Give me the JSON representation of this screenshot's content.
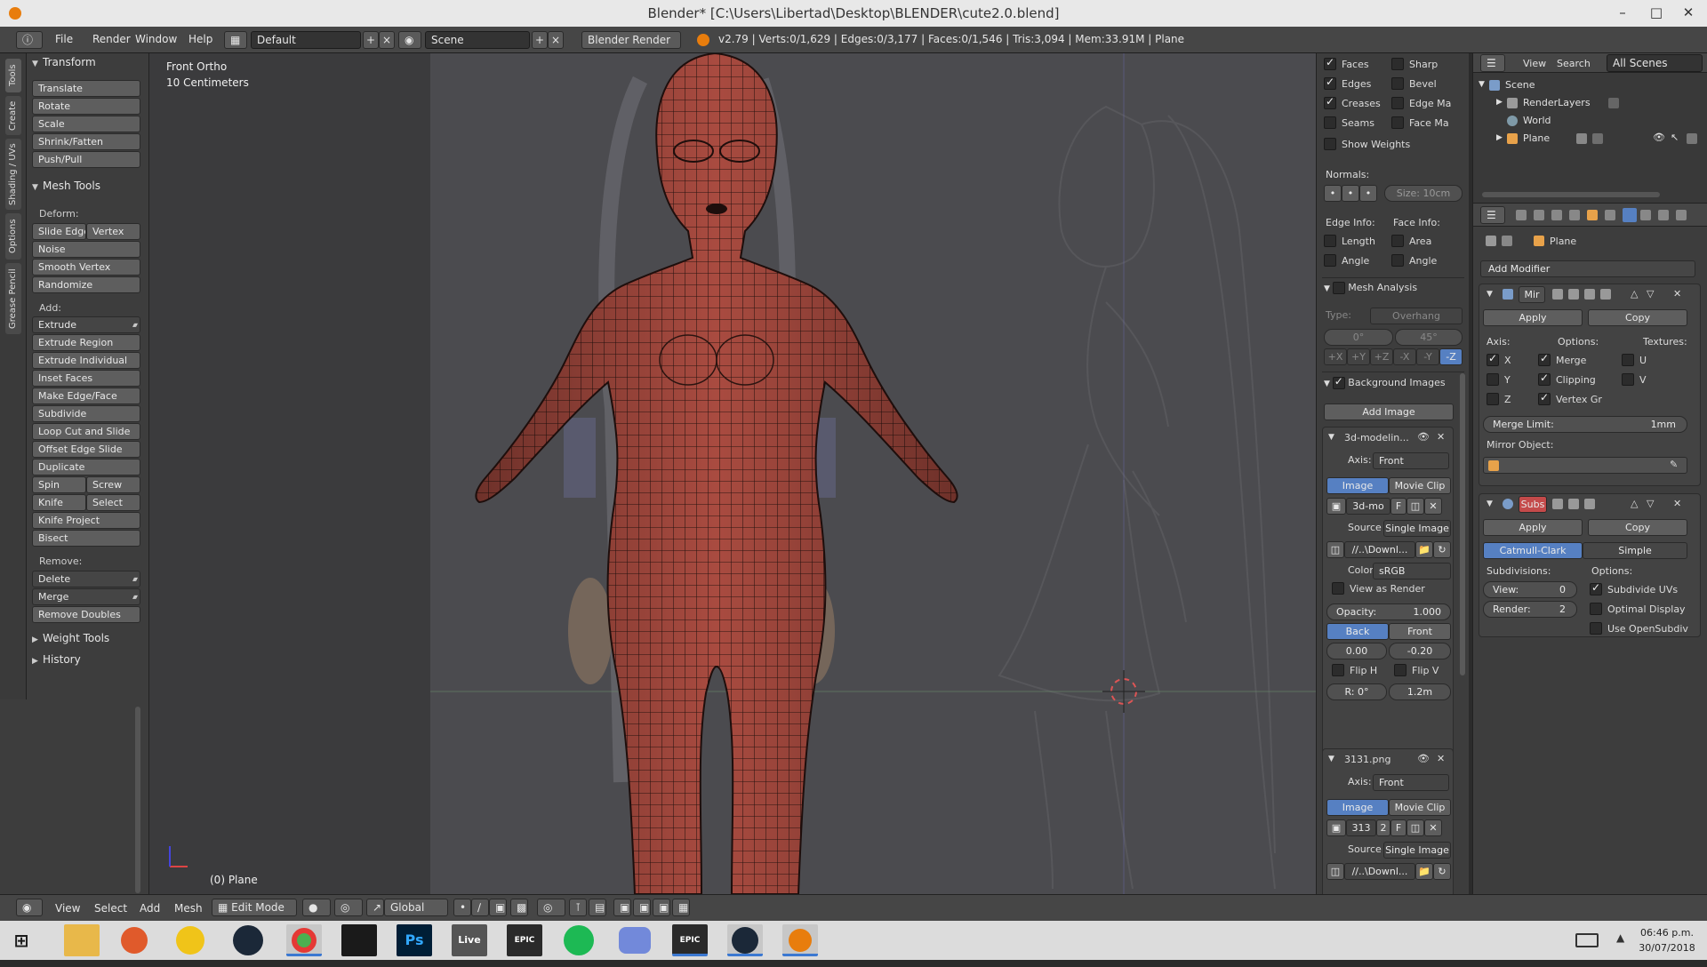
{
  "window": {
    "title": "Blender* [C:\\Users\\Libertad\\Desktop\\BLENDER\\cute2.0.blend]",
    "minimize": "–",
    "maximize": "□",
    "close": "✕"
  },
  "info_header": {
    "menus": [
      "File",
      "Render",
      "Window",
      "Help"
    ],
    "layout": "Default",
    "scene": "Scene",
    "engine": "Blender Render",
    "stats": "v2.79 | Verts:0/1,629 | Edges:0/3,177 | Faces:0/1,546 | Tris:3,094 | Mem:33.91M | Plane"
  },
  "tool_tabs": [
    "Tools",
    "Create",
    "Shading / UVs",
    "Options",
    "Grease Pencil"
  ],
  "tool_shelf": {
    "transform": {
      "title": "Transform",
      "buttons": [
        "Translate",
        "Rotate",
        "Scale",
        "Shrink/Fatten",
        "Push/Pull"
      ]
    },
    "mesh_tools": {
      "title": "Mesh Tools",
      "deform_label": "Deform:",
      "slide_edge": "Slide Edge",
      "vertex": "Vertex",
      "noise": "Noise",
      "smooth_vertex": "Smooth Vertex",
      "randomize": "Randomize",
      "add_label": "Add:",
      "extrude": "Extrude",
      "extrude_region": "Extrude Region",
      "extrude_individual": "Extrude Individual",
      "inset_faces": "Inset Faces",
      "make_edge_face": "Make Edge/Face",
      "subdivide": "Subdivide",
      "loop_cut": "Loop Cut and Slide",
      "offset_edge_slide": "Offset Edge Slide",
      "duplicate": "Duplicate",
      "spin": "Spin",
      "screw": "Screw",
      "knife": "Knife",
      "select": "Select",
      "knife_project": "Knife Project",
      "bisect": "Bisect",
      "remove_label": "Remove:",
      "delete": "Delete",
      "merge": "Merge",
      "remove_doubles": "Remove Doubles"
    },
    "weight_tools": "Weight Tools",
    "history": "History"
  },
  "viewport": {
    "view_name": "Front Ortho",
    "scale": "10 Centimeters",
    "object_label": "(0) Plane"
  },
  "npanel": {
    "overlays": [
      {
        "label": "Faces",
        "on": true
      },
      {
        "label": "Sharp",
        "on": false
      },
      {
        "label": "Edges",
        "on": true
      },
      {
        "label": "Bevel",
        "on": false
      },
      {
        "label": "Creases",
        "on": true
      },
      {
        "label": "Edge Ma",
        "on": false
      },
      {
        "label": "Seams",
        "on": false
      },
      {
        "label": "Face Ma",
        "on": false
      }
    ],
    "show_weights": "Show Weights",
    "normals_label": "Normals:",
    "normals_size": "Size: 10cm",
    "edge_info": "Edge Info:",
    "face_info": "Face Info:",
    "length": "Length",
    "area": "Area",
    "angle_e": "Angle",
    "angle_f": "Angle",
    "mesh_analysis": "Mesh Analysis",
    "type_label": "Type:",
    "type_value": "Overhang",
    "min_angle": "0°",
    "max_angle": "45°",
    "axes": [
      "+X",
      "+Y",
      "+Z",
      "-X",
      "-Y",
      "-Z"
    ],
    "background_images": "Background Images",
    "add_image": "Add Image",
    "bg1": {
      "name": "3d-modelin...",
      "axis_label": "Axis:",
      "axis": "Front",
      "image_tab": "Image",
      "movie_tab": "Movie Clip",
      "img_name": "3d-mo",
      "f_label": "F",
      "source_label": "Source",
      "source": "Single Image",
      "path": "//..\\Downl...",
      "color_label": "Color",
      "color": "sRGB",
      "view_as_render": "View as Render",
      "opacity": "Opacity:",
      "opacity_value": "1.000",
      "back": "Back",
      "front": "Front",
      "x_offset": "0.00",
      "y_offset": "-0.20",
      "flip_h": "Flip H",
      "flip_v": "Flip V",
      "rotation": "R: 0°",
      "size": "1.2m"
    },
    "bg2": {
      "name": "3131.png",
      "axis_label": "Axis:",
      "axis": "Front",
      "image_tab": "Image",
      "movie_tab": "Movie Clip",
      "img_name": "313",
      "users": "2",
      "f_label": "F",
      "source_label": "Source",
      "source": "Single Image",
      "path": "//..\\Downl..."
    }
  },
  "outliner": {
    "view": "View",
    "search": "Search",
    "filter": "All Scenes",
    "items": [
      "Scene",
      "RenderLayers",
      "World",
      "Plane"
    ]
  },
  "properties": {
    "breadcrumb": "Plane",
    "add_modifier": "Add Modifier",
    "mirror": {
      "name": "Mir",
      "apply": "Apply",
      "copy": "Copy",
      "axis_label": "Axis:",
      "options_label": "Options:",
      "textures_label": "Textures:",
      "x": "X",
      "y": "Y",
      "z": "Z",
      "merge": "Merge",
      "clipping": "Clipping",
      "vertex_gr": "Vertex Gr",
      "u": "U",
      "v": "V",
      "merge_limit": "Merge Limit:",
      "merge_limit_value": "1mm",
      "mirror_object": "Mirror Object:"
    },
    "subsurf": {
      "name": "Subs",
      "apply": "Apply",
      "copy": "Copy",
      "catmull": "Catmull-Clark",
      "simple": "Simple",
      "subdivisions": "Subdivisions:",
      "options": "Options:",
      "view": "View:",
      "view_value": "0",
      "render": "Render:",
      "render_value": "2",
      "subdivide_uvs": "Subdivide UVs",
      "optimal_display": "Optimal Display",
      "use_opensubdiv": "Use OpenSubdiv"
    }
  },
  "bottom_header": {
    "menus": [
      "View",
      "Select",
      "Add",
      "Mesh"
    ],
    "mode": "Edit Mode",
    "orientation": "Global"
  },
  "taskbar": {
    "time": "06:46 p.m.",
    "date": "30/07/2018",
    "apps": [
      "file-explorer",
      "snagit",
      "app",
      "steam",
      "chrome",
      "unreal",
      "photoshop",
      "live",
      "epic-games",
      "spotify",
      "discord",
      "epic-games",
      "steam",
      "blender"
    ]
  },
  "colors": {
    "accent": "#5680c2",
    "mesh": "#a94b40",
    "subsurf_badge": "#c44a4a"
  }
}
